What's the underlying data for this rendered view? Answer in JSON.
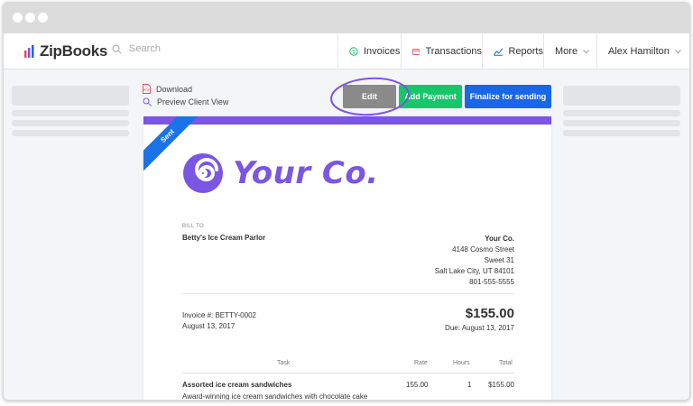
{
  "app": {
    "name": "ZipBooks",
    "search_placeholder": "Search"
  },
  "nav": {
    "invoices": "Invoices",
    "transactions": "Transactions",
    "reports": "Reports",
    "more": "More",
    "user": "Alex Hamilton"
  },
  "actions": {
    "download": "Download",
    "preview": "Preview Client View",
    "edit": "Edit",
    "add_payment": "Add Payment",
    "finalize": "Finalize for sending"
  },
  "invoice": {
    "status": "Sent",
    "company_logo_text": "Your Co.",
    "bill_to_label": "BILL TO",
    "client_name": "Betty's Ice Cream Parlor",
    "from": {
      "name": "Your Co.",
      "address1": "4148 Cosmo Street",
      "address2": "Sweet 31",
      "city": "Salt Lake City, UT 84101",
      "phone": "801-555-5555"
    },
    "number": "Invoice #: BETTY-0002",
    "date": "August 13, 2017",
    "total": "$155.00",
    "due": "Due: August 13, 2017",
    "columns": {
      "task": "Task",
      "rate": "Rate",
      "hours": "Hours",
      "total": "Total"
    },
    "items": [
      {
        "task": "Assorted ice cream sandwiches",
        "description": "Award-winning ice cream sandwiches with chocolate cake",
        "rate": "155.00",
        "hours": "1",
        "total": "$155.00"
      }
    ]
  },
  "colors": {
    "brand_purple": "#7b55e3",
    "edit_grey": "#8a8a8a",
    "payment_green": "#17c669",
    "finalize_blue": "#1a66e8",
    "ribbon_blue": "#1a73e8",
    "highlight_circle": "#7b55e3"
  }
}
